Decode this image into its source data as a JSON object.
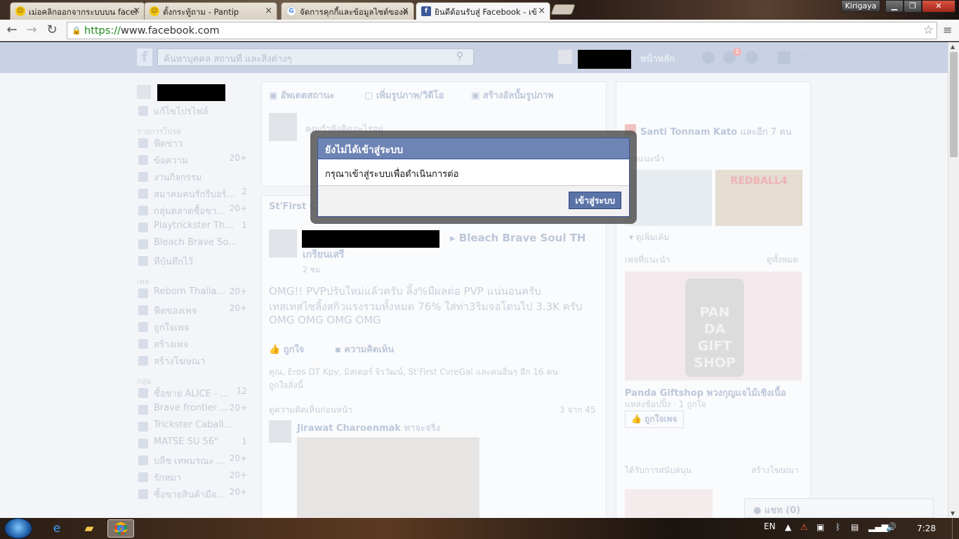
{
  "browser": {
    "tabs": [
      {
        "title": "เม่อคลิกออกจากระบบบน facel",
        "icon": "smiley-favicon-icon"
      },
      {
        "title": "ตั้งกระทู้ถาม - Pantip",
        "icon": "smiley-favicon-icon"
      },
      {
        "title": "จัดการคุกกี้และข้อมูลไซต์ของค",
        "icon": "google-favicon-icon"
      },
      {
        "title": "ยินดีต้อนรับสู่ Facebook - เข้",
        "icon": "facebook-favicon-icon"
      }
    ],
    "user_name": "Kirigaya",
    "url_scheme": "https://",
    "url_rest": "www.facebook.com"
  },
  "fb": {
    "search_placeholder": "ค้นหาบุคคล สถานที่ และสิ่งต่างๆ",
    "home": "หน้าหลัก",
    "notif_count": "1",
    "left_edit_profile": "แก้ไขโปรไฟล์",
    "left_fav_header": "รายการโปรด",
    "left_items": [
      {
        "label": "ฟีดข่าว",
        "count": ""
      },
      {
        "label": "ข้อความ",
        "count": "20+"
      },
      {
        "label": "งานกิจกรรม",
        "count": ""
      },
      {
        "label": "สมาคมคนรักรีบอร์...",
        "count": "2"
      },
      {
        "label": "กลุ่มตลาดซื้อขา...",
        "count": "20+"
      },
      {
        "label": "Playtrickster Th...",
        "count": "1"
      },
      {
        "label": "Bleach Brave So...",
        "count": ""
      },
      {
        "label": "ที่บันทึกไว้",
        "count": ""
      }
    ],
    "left_pages_header": "เพจ",
    "left_pages": [
      {
        "label": "Reborn Thaila...",
        "count": "20+"
      },
      {
        "label": "ฟีดของเพจ",
        "count": "20+"
      },
      {
        "label": "ถูกใจเพจ",
        "count": ""
      },
      {
        "label": "สร้างเพจ",
        "count": ""
      },
      {
        "label": "สร้างโฆษณา",
        "count": ""
      }
    ],
    "left_groups_header": "กลุ่ม",
    "left_groups": [
      {
        "label": "ซื้อขาย ALICE - ...",
        "count": "12"
      },
      {
        "label": "Brave frontier ...",
        "count": "20+"
      },
      {
        "label": "Trickster Caball...",
        "count": ""
      },
      {
        "label": "MATSE SU 56\"",
        "count": "1"
      },
      {
        "label": "บลีช เทพมรณะ ...",
        "count": "20+"
      },
      {
        "label": "รักหมา",
        "count": "20+"
      },
      {
        "label": "ซื้อขายสินค้ามือ...",
        "count": "20+"
      }
    ],
    "composer_update": "อัพเดตสถานะ",
    "composer_photo": "เพิ่มรูปภาพ/วิดีโอ",
    "composer_album": "สร้างอัลบั้มรูปภาพ",
    "composer_placeholder": "คุณกำลังคิดอะไรอยู่",
    "story_prefix": "St'First C",
    "post_page": "Bleach Brave Soul TH",
    "post_sub": "เกรียนเสรี",
    "post_time": "2 ชม.",
    "post_text_1": "OMG!! PVPปรับใหม่แล้วครับ ลิ้ง%มีผลต่อ PVP แน่นอนครับ",
    "post_text_2": "เทสเทสไซลิ้งสกิวแรงรวมทั้งหมด 76% ใส่ท่า3ริมจอโดนไป 3.3K ครับ",
    "post_text_3": "OMG OMG OMG OMG",
    "like": "ถูกใจ",
    "comment": "ความคิดเห็น",
    "likers": "คุณ, Eros DT Kpv, มิสเตอร์ จิรวัฒน์, St'First CvreGal และคนอื่นๆ อีก 16 คน",
    "likers_2": "ถูกใจสิ่งนี้",
    "prev_comments": "ดูความคิดเห็นก่อนหน้า",
    "comments_count": "3 จาก 45",
    "commenter": "Jirawat Charoenmak",
    "commenter_tag": "ทาจะจริง",
    "right_friend_name": "Santi Tonnam Kato",
    "right_friend_more": "และอีก 7 คน",
    "right_games": "เกมแนะนำ",
    "right_see_more": "ดูเพิ่มเติม",
    "right_pages_header": "เพจที่แนะนำ",
    "right_see_all": "ดูทั้งหมด",
    "right_page_name": "Panda Giftshop พวงกุญแจไม้เชิงเนื้อ",
    "right_page_cat": "แหล่งช้อปปิ้ง · 1 ถูกใจ",
    "right_like_page": "ถูกใจเพจ",
    "right_sponsored": "ได้รับการสนับสนุน",
    "right_create_ad": "สร้างโฆษณา",
    "redball": "REDBALL4",
    "panda_lines": [
      "PAN",
      "DA",
      "GIFT",
      "SHOP"
    ],
    "chat": "แชท (0)"
  },
  "dialog": {
    "title": "ยังไม่ได้เข้าสู่ระบบ",
    "message": "กรุณาเข้าสู่ระบบเพื่อดำเนินการต่อ",
    "button": "เข้าสู่ระบบ"
  },
  "taskbar": {
    "lang": "EN",
    "time": "7:28"
  },
  "colors": {
    "fb_blue": "#3b5998",
    "dialog_header": "#6d84b4",
    "button": "#5b74a8"
  }
}
